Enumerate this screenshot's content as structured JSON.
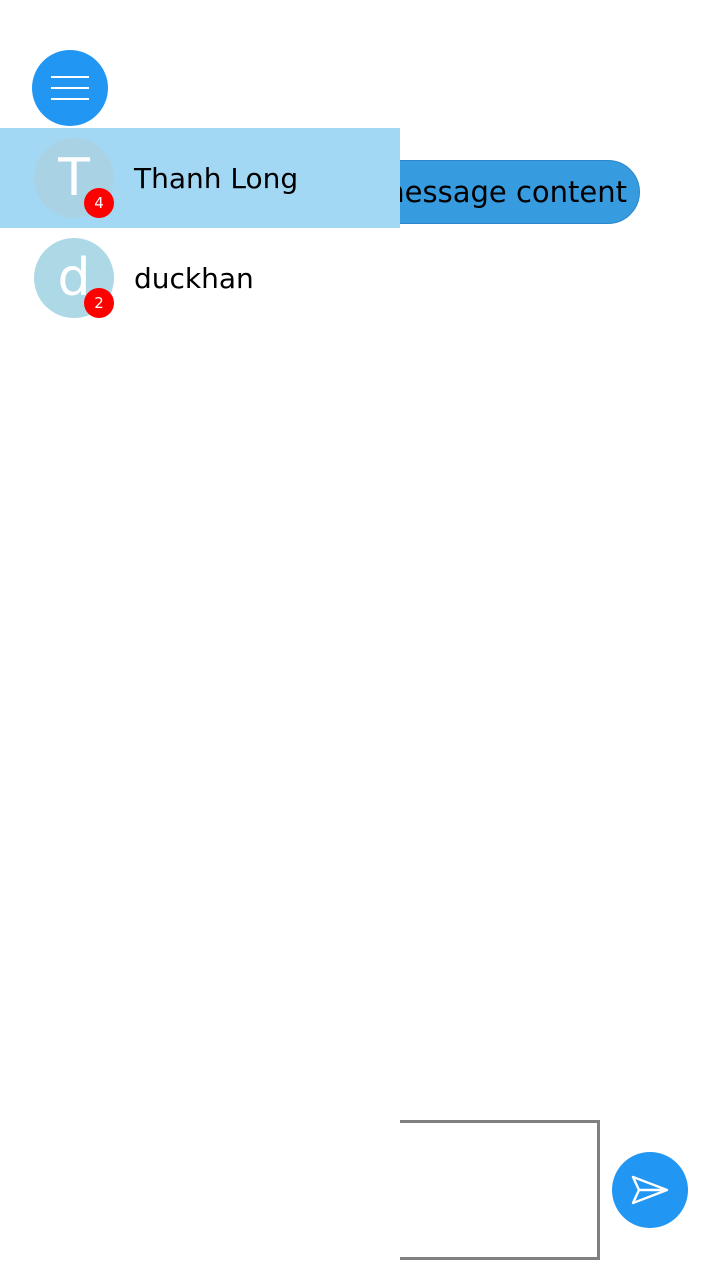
{
  "header": {
    "menu_icon": "hamburger-menu-icon"
  },
  "chat": {
    "message_text": "message content"
  },
  "contacts": [
    {
      "initial": "T",
      "name": "Thanh Long",
      "unread": "4",
      "selected": true
    },
    {
      "initial": "d",
      "name": "duckhan",
      "unread": "2",
      "selected": false
    }
  ],
  "composer": {
    "input_value": "",
    "send_icon": "send-icon"
  },
  "colors": {
    "accent": "#2196f3",
    "selected_row": "#a3d8f4",
    "avatar": "#add8e6",
    "badge": "#ff0000",
    "bubble": "#379bdf"
  }
}
